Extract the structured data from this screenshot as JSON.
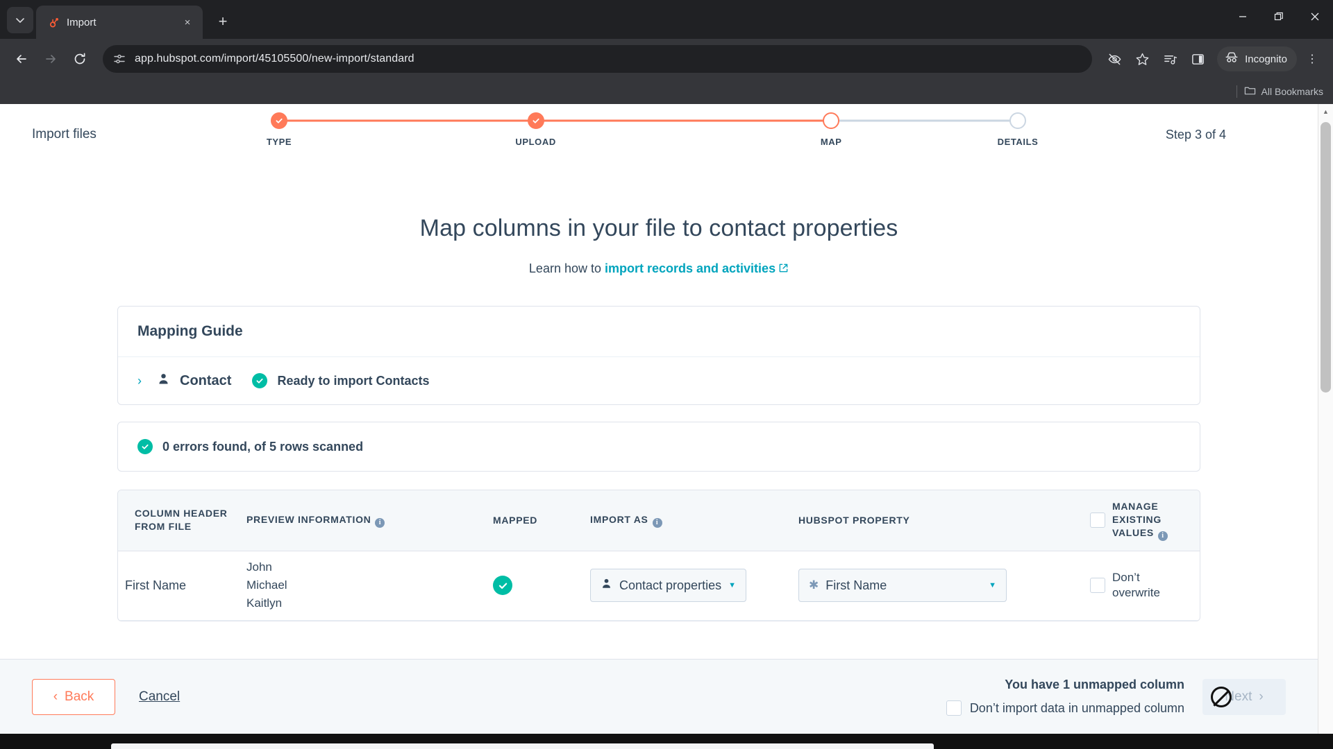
{
  "browser": {
    "tab": {
      "title": "Import",
      "favicon": "hubspot-sprocket-icon",
      "close_label": "×"
    },
    "newtab_label": "+",
    "chevron_label": "⌄",
    "window_controls": {
      "minimize": "–",
      "maximize": "❐",
      "close": "✕"
    },
    "nav": {
      "back": "←",
      "forward": "→",
      "reload": "↻"
    },
    "omnibox": {
      "url": "app.hubspot.com/import/45105500/new-import/standard",
      "site_icon": "page-settings-icon"
    },
    "toolbar_icons": [
      "eye-slash-icon",
      "star-icon",
      "media-list-icon",
      "side-panel-icon"
    ],
    "profile": {
      "label": "Incognito",
      "icon": "incognito-hat-icon"
    },
    "menu_label": "⋮",
    "bookmarks": {
      "all_label": "All Bookmarks",
      "folder_icon": "folder-icon"
    }
  },
  "stepper": {
    "title": "Import files",
    "steps": [
      {
        "label": "TYPE",
        "state": "done"
      },
      {
        "label": "UPLOAD",
        "state": "done"
      },
      {
        "label": "MAP",
        "state": "current"
      },
      {
        "label": "DETAILS",
        "state": "todo"
      }
    ],
    "counter": "Step 3 of 4",
    "accent": "#ff7a59",
    "inactive": "#cbd6e2"
  },
  "main": {
    "title": "Map columns in your file to contact properties",
    "subtitle_prefix": "Learn how to ",
    "subtitle_link": "import records and activities",
    "link_color": "#00a4bd"
  },
  "mapping_guide": {
    "heading": "Mapping Guide",
    "object": {
      "name": "Contact",
      "status": "Ready to import Contacts",
      "status_color": "#00bda5",
      "chevron": "›"
    }
  },
  "errors_banner": {
    "text": "0 errors found, of 5 rows scanned",
    "status_color": "#00bda5"
  },
  "table": {
    "headers": [
      {
        "label": "COLUMN HEADER FROM FILE",
        "info": false
      },
      {
        "label": "PREVIEW INFORMATION",
        "info": true
      },
      {
        "label": "MAPPED",
        "info": false
      },
      {
        "label": "IMPORT AS",
        "info": true
      },
      {
        "label": "HUBSPOT PROPERTY",
        "info": false
      },
      {
        "label": "MANAGE EXISTING VALUES",
        "info": true
      }
    ],
    "rows": [
      {
        "column_header": "First Name",
        "preview": [
          "John",
          "Michael",
          "Kaitlyn"
        ],
        "mapped": true,
        "import_as": "Contact properties",
        "import_as_icon": "contact-icon",
        "hubspot_property": "First Name",
        "property_prefix": "✱",
        "dont_overwrite_label": "Don’t overwrite",
        "dont_overwrite_checked": false
      }
    ]
  },
  "footer": {
    "back_label": "Back",
    "back_chevron": "‹",
    "cancel_label": "Cancel",
    "unmapped_title": "You have 1 unmapped column",
    "unmapped_checkbox_label": "Don’t import data in unmapped column",
    "unmapped_checked": false,
    "next_label": "Next",
    "next_chevron": "›",
    "next_disabled": true
  }
}
